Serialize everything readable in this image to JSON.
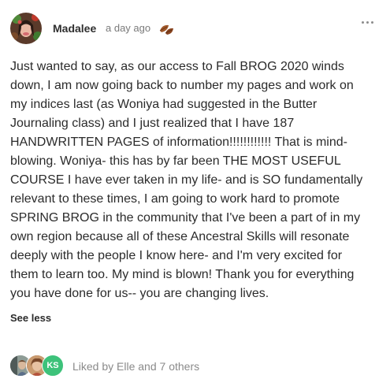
{
  "post": {
    "author": "Madalee",
    "timestamp": "a day ago",
    "author_avatar_icon": "profile-photo",
    "badge_icon": "autumn-leaves-icon",
    "more_icon": "horizontal-ellipsis-icon",
    "body_lines": [
      "Just wanted to say, as our access to Fall BROG 2020 winds",
      "down, I am now going back to number my pages and work on",
      "my indices last (as Woniya had suggested in the Butter",
      "Journaling class) and I just realized that I have 187",
      "HANDWRITTEN PAGES of information!!!!!!!!!!!! That is mind-",
      "blowing. Woniya- this has by far been THE MOST USEFUL",
      "COURSE I have ever taken in my life- and is SO fundamentally",
      "relevant to these times, I am going to work hard to promote",
      "SPRING BROG in the community that I've been a part of in my",
      "own region because all of these Ancestral Skills will resonate",
      "deeply with the people I know here- and I'm very excited for",
      "them to learn too. My mind is blown! Thank you for everything",
      "you have done for us-- you are changing lives."
    ],
    "see_less": "See less"
  },
  "likes": {
    "avatars": [
      {
        "kind": "photo"
      },
      {
        "kind": "photo"
      },
      {
        "kind": "initials",
        "initials": "KS",
        "color": "#3dc27a"
      }
    ],
    "liked_by_text": "Liked by Elle and 7 others"
  },
  "colors": {
    "text": "#2b2b2b",
    "muted": "#7a7a7a",
    "likes_text": "#8a8a8a",
    "initials_badge": "#3dc27a"
  }
}
